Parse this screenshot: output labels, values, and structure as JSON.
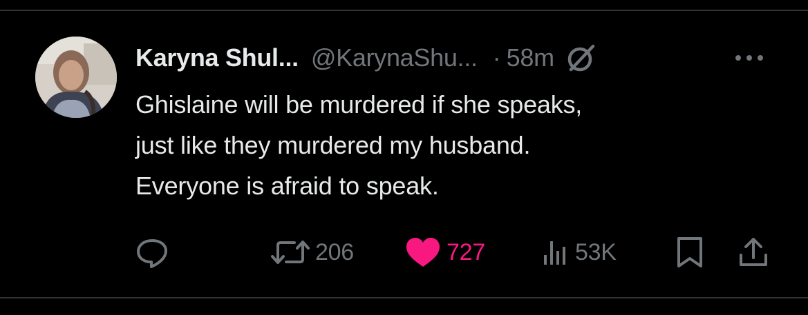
{
  "post": {
    "author_name": "Karyna Shul...",
    "author_handle": "@KarynaShu...",
    "separator": "·",
    "time": "58m",
    "text_lines": [
      "Ghislaine will be murdered if she speaks,",
      "just like they murdered my husband.",
      "Everyone is afraid to speak."
    ]
  },
  "actions": {
    "reply": {
      "icon": "reply-icon"
    },
    "repost": {
      "icon": "repost-icon",
      "count": "206"
    },
    "like": {
      "icon": "heart-icon",
      "count": "727",
      "liked": true
    },
    "views": {
      "icon": "views-icon",
      "count": "53K"
    },
    "bookmark": {
      "icon": "bookmark-icon"
    },
    "share": {
      "icon": "share-icon"
    }
  },
  "colors": {
    "background": "#000000",
    "primary_text": "#e7e9ea",
    "secondary_text": "#71767b",
    "like_accent": "#f91880",
    "divider": "#2f3336"
  }
}
